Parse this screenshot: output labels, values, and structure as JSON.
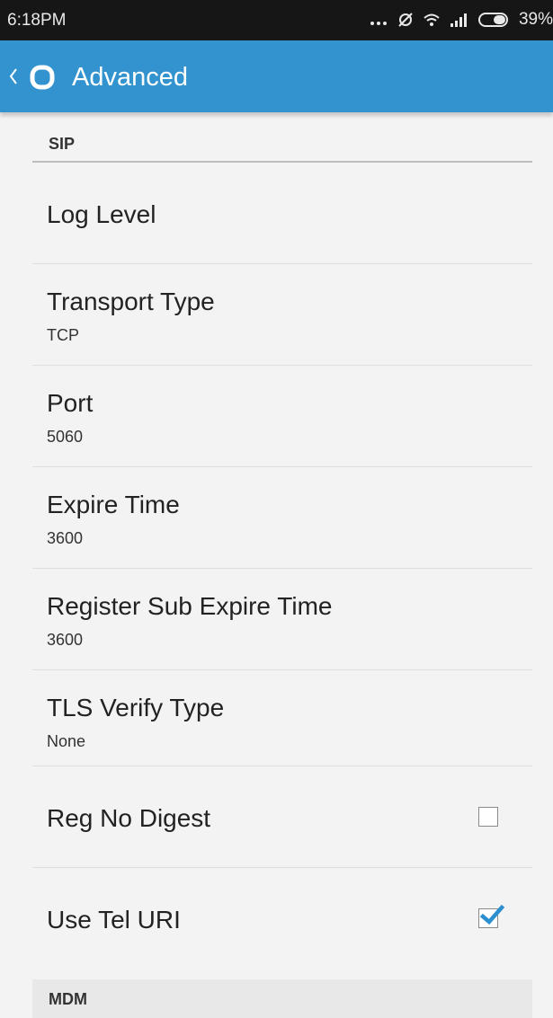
{
  "status_bar": {
    "time": "6:18PM",
    "icons": [
      "more-icon",
      "sync-off-icon",
      "wifi-icon",
      "signal-icon",
      "battery-icon"
    ],
    "battery": "39%"
  },
  "app_bar": {
    "title": "Advanced",
    "back_icon": "chevron-left-icon",
    "logo_icon": "app-logo-icon",
    "background": "#3293cf"
  },
  "sections": [
    {
      "header": "SIP",
      "items": [
        {
          "label": "Log Level",
          "value": ""
        },
        {
          "label": "Transport Type",
          "value": "TCP"
        },
        {
          "label": "Port",
          "value": "5060"
        },
        {
          "label": "Expire Time",
          "value": "3600"
        },
        {
          "label": "Register Sub Expire Time",
          "value": "3600"
        },
        {
          "label": "TLS Verify Type",
          "value": "None"
        },
        {
          "label": "Reg No Digest",
          "checked": false
        },
        {
          "label": "Use Tel URI",
          "checked": true
        }
      ]
    },
    {
      "header": "MDM"
    }
  ],
  "colors": {
    "accent": "#3293cf",
    "checkbox_checked": "#2b8fd0"
  }
}
